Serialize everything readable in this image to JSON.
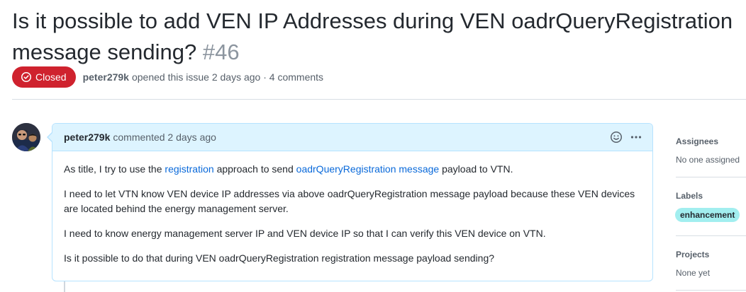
{
  "issue": {
    "title": "Is it possible to add VEN IP Addresses during VEN oadrQueryRegistration",
    "title_line2": "message sending?",
    "number": "#46",
    "state": "Closed",
    "author": "peter279k",
    "opened_text": "opened this issue 2 days ago · 4 comments"
  },
  "comment": {
    "author": "peter279k",
    "action": "commented 2 days ago",
    "p1_before": "As title, I try to use the",
    "p1_link1": "registration",
    "p1_middle": "approach to send",
    "p1_link2": "oadrQueryRegistration message",
    "p1_after": "payload to VTN.",
    "p2": "I need to let VTN know VEN device IP addresses via above oadrQueryRegistration message payload because these VEN devices are located behind the energy management server.",
    "p3": "I need to know energy management server IP and VEN device IP so that I can verify this VEN device on VTN.",
    "p4": "Is it possible to do that during VEN oadrQueryRegistration registration message payload sending?"
  },
  "sidebar": {
    "assignees_heading": "Assignees",
    "assignees_value": "No one assigned",
    "labels_heading": "Labels",
    "label": "enhancement",
    "projects_heading": "Projects",
    "projects_value": "None yet"
  },
  "icons": {
    "state": "issue-closed-icon",
    "emoji": "smiley-icon",
    "more": "kebab-horizontal-icon"
  },
  "colors": {
    "closed": "#cf222e",
    "comment_header": "#ddf4ff",
    "comment_border": "#b6e3ff",
    "link": "#0969da",
    "label_bg": "#a2eeef"
  }
}
